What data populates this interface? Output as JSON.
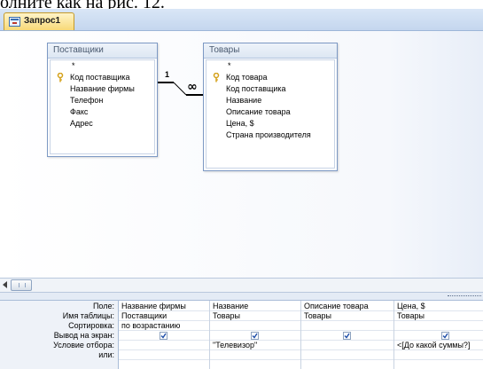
{
  "page_caption": "олните как на рис. 12.",
  "tab": {
    "label": "Запрос1",
    "icon": "query-icon"
  },
  "tables": [
    {
      "title": "Поставщики",
      "fields": [
        "*",
        "Код поставщика",
        "Название фирмы",
        "Телефон",
        "Факс",
        "Адрес"
      ],
      "key_field_index": 1
    },
    {
      "title": "Товары",
      "fields": [
        "*",
        "Код товара",
        "Код поставщика",
        "Название",
        "Описание товара",
        "Цена, $",
        "Страна производителя"
      ],
      "key_field_index": 1
    }
  ],
  "relationship": {
    "one_side": "1",
    "many_side": "∞"
  },
  "grid": {
    "row_labels": [
      "Поле:",
      "Имя таблицы:",
      "Сортировка:",
      "Вывод на экран:",
      "Условие отбора:",
      "или:"
    ],
    "columns": [
      {
        "field": "Название фирмы",
        "table": "Поставщики",
        "sort": "по возрастанию",
        "show": true,
        "criteria": ""
      },
      {
        "field": "Название",
        "table": "Товары",
        "sort": "",
        "show": true,
        "criteria": "\"Телевизор\""
      },
      {
        "field": "Описание товара",
        "table": "Товары",
        "sort": "",
        "show": true,
        "criteria": ""
      },
      {
        "field": "Цена, $",
        "table": "Товары",
        "sort": "",
        "show": true,
        "criteria": "<[До какой суммы?]"
      }
    ]
  },
  "colors": {
    "key_icon": "#d4a017",
    "relation_line": "#000000",
    "accent": "#7d99c4"
  }
}
